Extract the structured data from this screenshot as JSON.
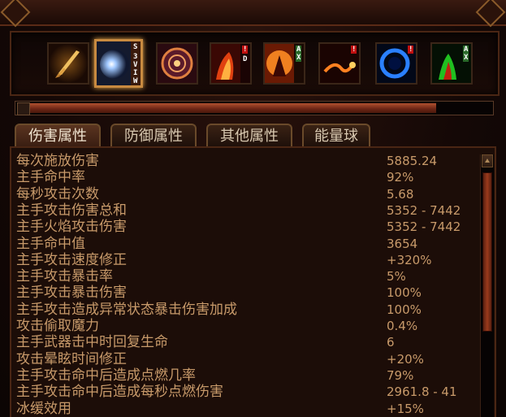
{
  "skills": [
    {
      "name": "sword-skill-icon",
      "badges": []
    },
    {
      "name": "frost-orb-skill-icon",
      "badges": [
        "S",
        "3",
        "V",
        "I",
        "W"
      ],
      "selected": true
    },
    {
      "name": "rune-circle-skill-icon",
      "badges": []
    },
    {
      "name": "fire-demon-skill-icon",
      "badges": [
        "!",
        "D"
      ]
    },
    {
      "name": "fire-warrior-skill-icon",
      "badges": [
        "A",
        "X"
      ]
    },
    {
      "name": "fire-whip-skill-icon",
      "badges": [
        "!"
      ]
    },
    {
      "name": "blue-vortex-skill-icon",
      "badges": [
        "!"
      ]
    },
    {
      "name": "green-flame-skill-icon",
      "badges": [
        "A",
        "X"
      ]
    }
  ],
  "progress": {
    "fraction": 0.88
  },
  "tabs": [
    {
      "label": "伤害属性",
      "active": true
    },
    {
      "label": "防御属性",
      "active": false
    },
    {
      "label": "其他属性",
      "active": false
    },
    {
      "label": "能量球",
      "active": false
    }
  ],
  "stats": [
    {
      "name": "每次施放伤害",
      "value": "5885.24"
    },
    {
      "name": "主手命中率",
      "value": "92%"
    },
    {
      "name": "每秒攻击次数",
      "value": "5.68"
    },
    {
      "name": "主手攻击伤害总和",
      "value": "5352 - 7442"
    },
    {
      "name": "主手火焰攻击伤害",
      "value": "5352 - 7442"
    },
    {
      "name": "主手命中值",
      "value": "3654"
    },
    {
      "name": "主手攻击速度修正",
      "value": "+320%"
    },
    {
      "name": "主手攻击暴击率",
      "value": "5%"
    },
    {
      "name": "主手攻击暴击伤害",
      "value": "100%"
    },
    {
      "name": "主手攻击造成异常状态暴击伤害加成",
      "value": "100%"
    },
    {
      "name": "攻击偷取魔力",
      "value": "0.4%"
    },
    {
      "name": "主手武器击中时回复生命",
      "value": "6"
    },
    {
      "name": "攻击晕眩时间修正",
      "value": "+20%"
    },
    {
      "name": "主手攻击命中后造成点燃几率",
      "value": "79%"
    },
    {
      "name": "主手攻击命中后造成每秒点燃伤害",
      "value": "2961.8 - 41"
    },
    {
      "name": "冰缓效用",
      "value": "+15%"
    }
  ],
  "colors": {
    "stat_text": "#c89a6a",
    "tab_text": "#d8c8b0",
    "frame": "#4a2614"
  }
}
